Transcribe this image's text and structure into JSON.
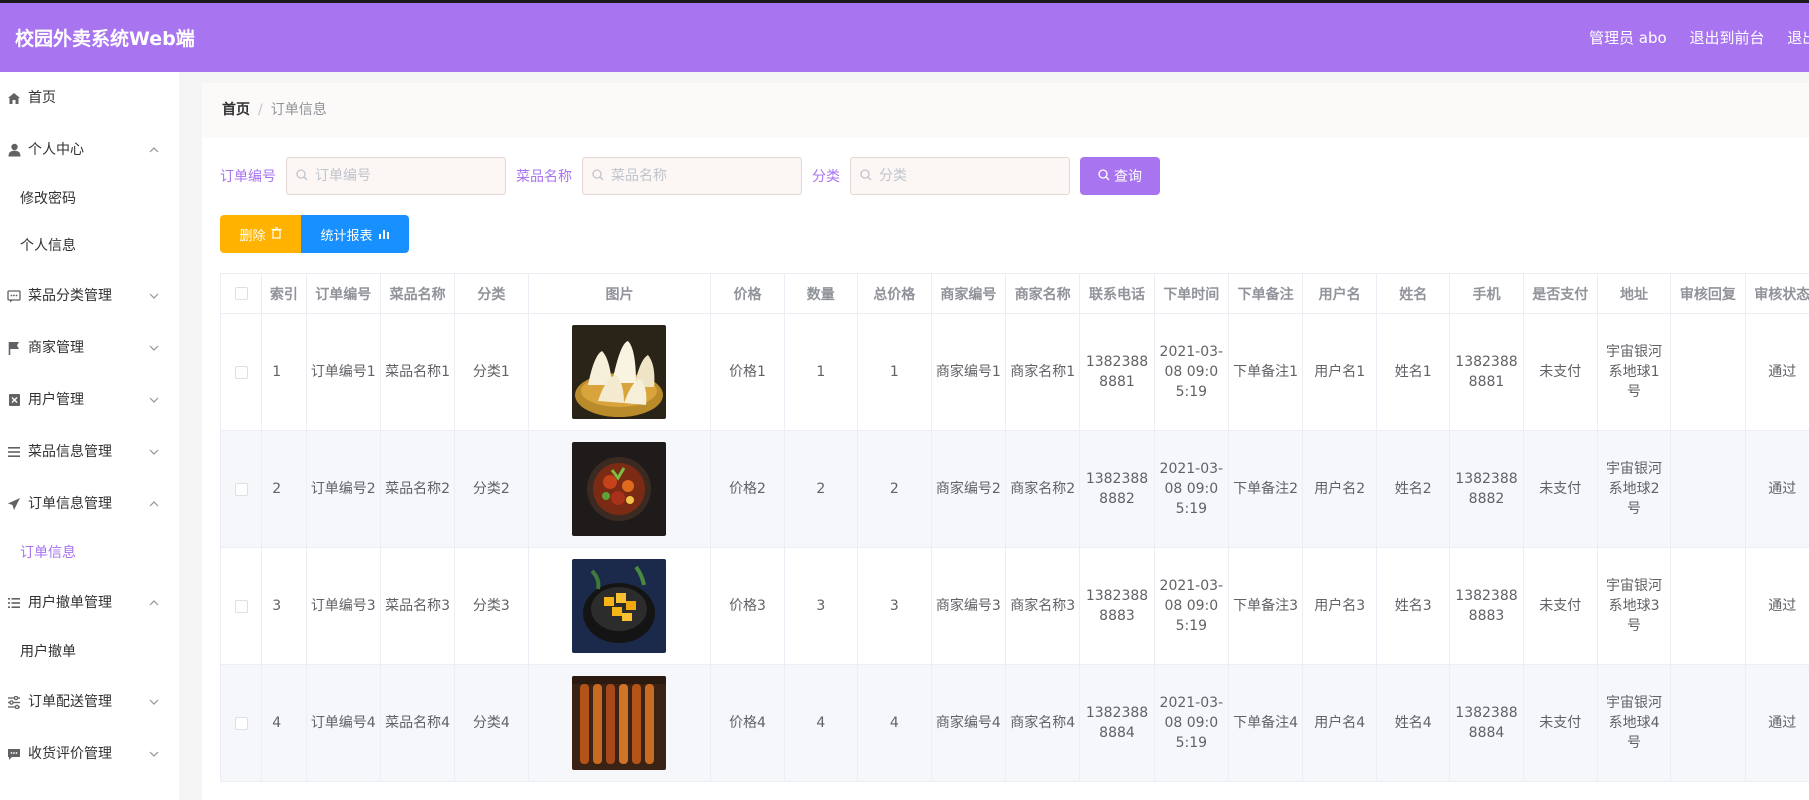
{
  "app_title": "校园外卖系统Web端",
  "top_right": {
    "user": "管理员 abo",
    "to_front": "退出到前台",
    "logout": "退出登录"
  },
  "sidebar": {
    "items": [
      {
        "key": "home",
        "label": "首页",
        "icon": "home-icon",
        "arrow": ""
      },
      {
        "key": "personal",
        "label": "个人中心",
        "icon": "user-icon",
        "arrow": "up",
        "children": [
          "修改密码",
          "个人信息"
        ]
      },
      {
        "key": "dish-cat",
        "label": "菜品分类管理",
        "icon": "chat-icon",
        "arrow": "down"
      },
      {
        "key": "merchant",
        "label": "商家管理",
        "icon": "flag-icon",
        "arrow": "down"
      },
      {
        "key": "user",
        "label": "用户管理",
        "icon": "delete-box-icon",
        "arrow": "down"
      },
      {
        "key": "dish-info",
        "label": "菜品信息管理",
        "icon": "menu-icon",
        "arrow": "down"
      },
      {
        "key": "order",
        "label": "订单信息管理",
        "icon": "send-icon",
        "arrow": "up",
        "children": [
          "订单信息"
        ],
        "active_child": 0
      },
      {
        "key": "cancel",
        "label": "用户撤单管理",
        "icon": "list-icon",
        "arrow": "up",
        "children": [
          "用户撤单"
        ]
      },
      {
        "key": "delivery",
        "label": "订单配送管理",
        "icon": "operation-icon",
        "arrow": "down"
      },
      {
        "key": "review",
        "label": "收货评价管理",
        "icon": "comment-icon",
        "arrow": "down"
      }
    ]
  },
  "breadcrumb": {
    "home": "首页",
    "separator": "/",
    "current": "订单信息"
  },
  "search": {
    "fields": [
      {
        "label": "订单编号",
        "placeholder": "订单编号"
      },
      {
        "label": "菜品名称",
        "placeholder": "菜品名称"
      },
      {
        "label": "分类",
        "placeholder": "分类"
      }
    ],
    "query_label": "查询"
  },
  "actions": {
    "delete_label": "删除",
    "stats_label": "统计报表"
  },
  "table": {
    "columns": [
      "",
      "索引",
      "订单编号",
      "菜品名称",
      "分类",
      "图片",
      "价格",
      "数量",
      "总价格",
      "商家编号",
      "商家名称",
      "联系电话",
      "下单时间",
      "下单备注",
      "用户名",
      "姓名",
      "手机",
      "是否支付",
      "地址",
      "审核回复",
      "审核状态"
    ],
    "rows": [
      {
        "index": "1",
        "order_no": "订单编号1",
        "dish": "菜品名称1",
        "category": "分类1",
        "image": "dumplings",
        "price": "价格1",
        "qty": "1",
        "total": "1",
        "merchant_no": "商家编号1",
        "merchant_name": "商家名称1",
        "phone": "13823888881",
        "time": "2021-03-08 09:05:19",
        "remark": "下单备注1",
        "username": "用户名1",
        "name": "姓名1",
        "mobile": "13823888881",
        "paid": "未支付",
        "address": "宇宙银河系地球1号",
        "reply": "",
        "status": "通过"
      },
      {
        "index": "2",
        "order_no": "订单编号2",
        "dish": "菜品名称2",
        "category": "分类2",
        "image": "stir-fry",
        "price": "价格2",
        "qty": "2",
        "total": "2",
        "merchant_no": "商家编号2",
        "merchant_name": "商家名称2",
        "phone": "13823888882",
        "time": "2021-03-08 09:05:19",
        "remark": "下单备注2",
        "username": "用户名2",
        "name": "姓名2",
        "mobile": "13823888882",
        "paid": "未支付",
        "address": "宇宙银河系地球2号",
        "reply": "",
        "status": "通过"
      },
      {
        "index": "3",
        "order_no": "订单编号3",
        "dish": "菜品名称3",
        "category": "分类3",
        "image": "mango-bowl",
        "price": "价格3",
        "qty": "3",
        "total": "3",
        "merchant_no": "商家编号3",
        "merchant_name": "商家名称3",
        "phone": "13823888883",
        "time": "2021-03-08 09:05:19",
        "remark": "下单备注3",
        "username": "用户名3",
        "name": "姓名3",
        "mobile": "13823888883",
        "paid": "未支付",
        "address": "宇宙银河系地球3号",
        "reply": "",
        "status": "通过"
      },
      {
        "index": "4",
        "order_no": "订单编号4",
        "dish": "菜品名称4",
        "category": "分类4",
        "image": "skewers",
        "price": "价格4",
        "qty": "4",
        "total": "4",
        "merchant_no": "商家编号4",
        "merchant_name": "商家名称4",
        "phone": "13823888884",
        "time": "2021-03-08 09:05:19",
        "remark": "下单备注4",
        "username": "用户名4",
        "name": "姓名4",
        "mobile": "13823888884",
        "paid": "未支付",
        "address": "宇宙银河系地球4号",
        "reply": "",
        "status": "通过"
      }
    ]
  },
  "colors": {
    "primary": "#a874f0",
    "delete": "#ffb300",
    "stats": "#1890ff"
  }
}
